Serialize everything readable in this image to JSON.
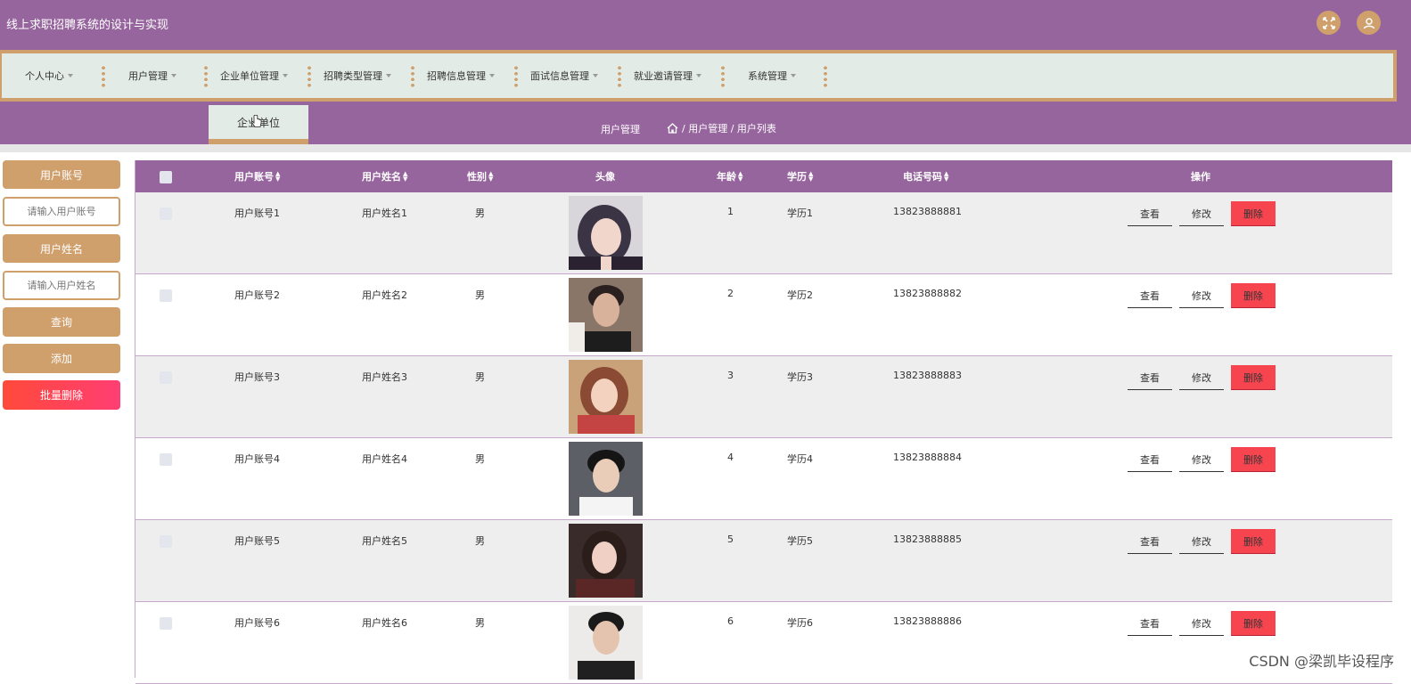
{
  "app": {
    "title": "线上求职招聘系统的设计与实现"
  },
  "nav": [
    {
      "label": "个人中心"
    },
    {
      "label": "用户管理"
    },
    {
      "label": "企业单位管理"
    },
    {
      "label": "招聘类型管理"
    },
    {
      "label": "招聘信息管理"
    },
    {
      "label": "面试信息管理"
    },
    {
      "label": "就业邀请管理"
    },
    {
      "label": "系统管理"
    }
  ],
  "tabs": {
    "active": "企业单位",
    "current_title": "用户管理"
  },
  "breadcrumb": {
    "text": "/ 用户管理 / 用户列表"
  },
  "sidebar": {
    "account_label": "用户账号",
    "account_placeholder": "请输入用户账号",
    "name_label": "用户姓名",
    "name_placeholder": "请输入用户姓名",
    "search_btn": "查询",
    "add_btn": "添加",
    "batch_delete_btn": "批量删除"
  },
  "table": {
    "headers": {
      "account": "用户账号",
      "name": "用户姓名",
      "gender": "性别",
      "avatar": "头像",
      "age": "年龄",
      "education": "学历",
      "phone": "电话号码",
      "actions": "操作"
    },
    "view_label": "查看",
    "edit_label": "修改",
    "delete_label": "删除",
    "rows": [
      {
        "account": "用户账号1",
        "name": "用户姓名1",
        "gender": "男",
        "age": "1",
        "education": "学历1",
        "phone": "13823888881"
      },
      {
        "account": "用户账号2",
        "name": "用户姓名2",
        "gender": "男",
        "age": "2",
        "education": "学历2",
        "phone": "13823888882"
      },
      {
        "account": "用户账号3",
        "name": "用户姓名3",
        "gender": "男",
        "age": "3",
        "education": "学历3",
        "phone": "13823888883"
      },
      {
        "account": "用户账号4",
        "name": "用户姓名4",
        "gender": "男",
        "age": "4",
        "education": "学历4",
        "phone": "13823888884"
      },
      {
        "account": "用户账号5",
        "name": "用户姓名5",
        "gender": "男",
        "age": "5",
        "education": "学历5",
        "phone": "13823888885"
      },
      {
        "account": "用户账号6",
        "name": "用户姓名6",
        "gender": "男",
        "age": "6",
        "education": "学历6",
        "phone": "13823888886"
      }
    ]
  },
  "watermark": "CSDN @梁凯毕设程序",
  "colors": {
    "primary": "#96659d",
    "accent": "#cf9f6c",
    "nav_bg": "#e3ebe6",
    "danger": "#f74550"
  }
}
